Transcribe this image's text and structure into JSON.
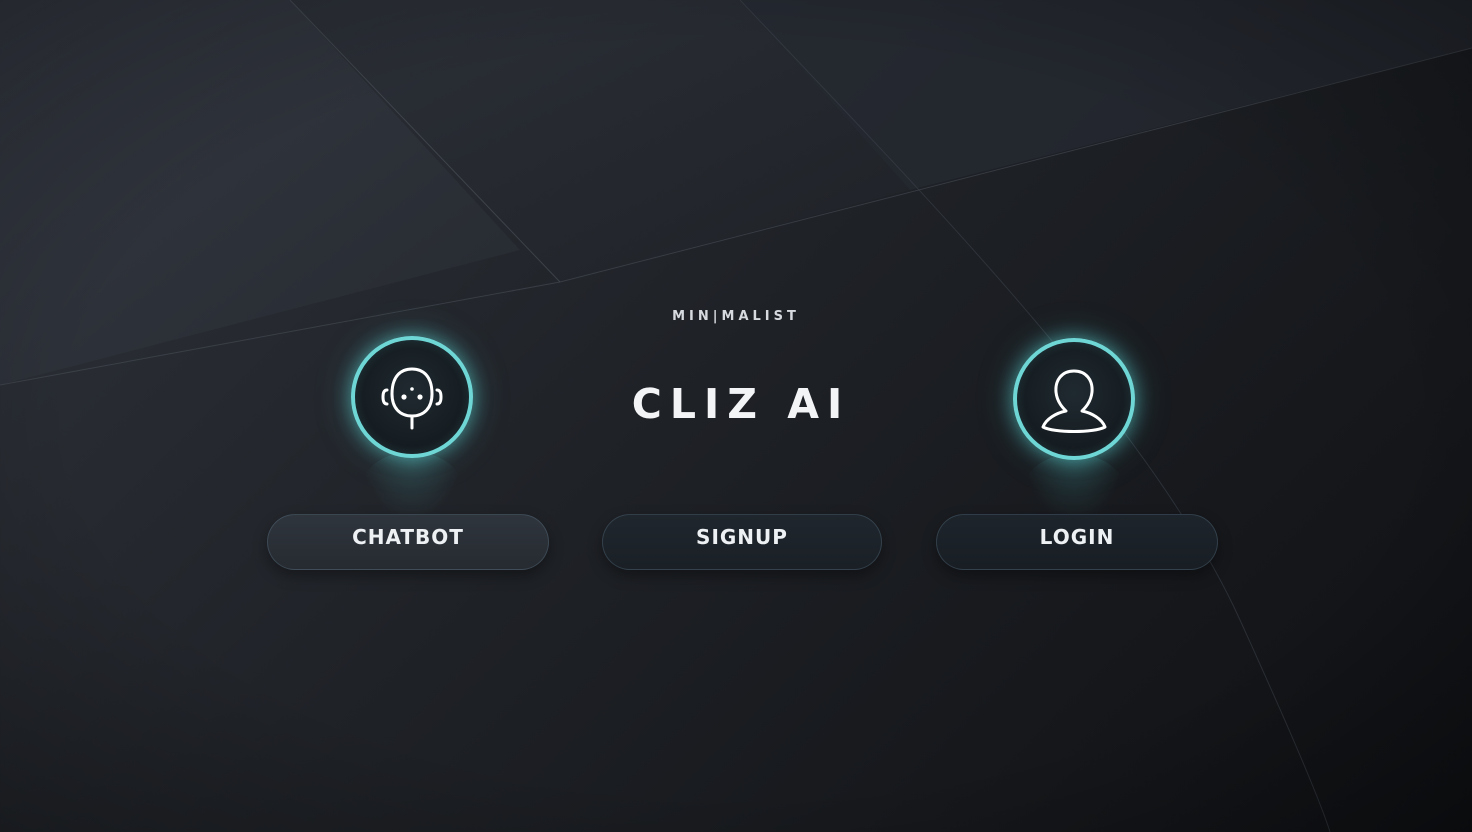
{
  "header": {
    "eyebrow": "MIN|MALIST",
    "brand": "CLIZ AI"
  },
  "actions": [
    {
      "id": "chatbot",
      "label": "CHATBOT",
      "icon": "robot-headset-icon"
    },
    {
      "id": "signup",
      "label": "SIGNUP"
    },
    {
      "id": "login",
      "label": "LOGIN",
      "icon": "user-silhouette-icon"
    }
  ],
  "theme": {
    "accent": "#6fd6d6",
    "background": "#1f2227",
    "text": "#f3f4f6"
  }
}
